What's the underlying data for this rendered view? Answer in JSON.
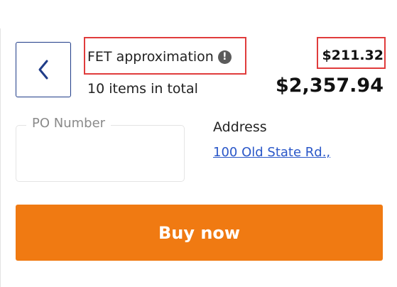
{
  "header": {
    "back_icon": "chevron-left-icon",
    "fet_label": "FET approximation",
    "fet_info_icon": "info-circle-icon",
    "fet_info_glyph": "!",
    "fet_amount": "$211.32",
    "items_total": "10 items in total",
    "total_amount": "$2,357.94"
  },
  "form": {
    "po_number_label": "PO Number",
    "po_number_value": "",
    "address_heading": "Address",
    "address_link": "100 Old State Rd.,"
  },
  "actions": {
    "buy_now_label": "Buy now"
  },
  "colors": {
    "accent": "#f07a12",
    "highlight_border": "#e03c3c",
    "link": "#2a57c8",
    "back_button_border": "#1f3c88"
  }
}
